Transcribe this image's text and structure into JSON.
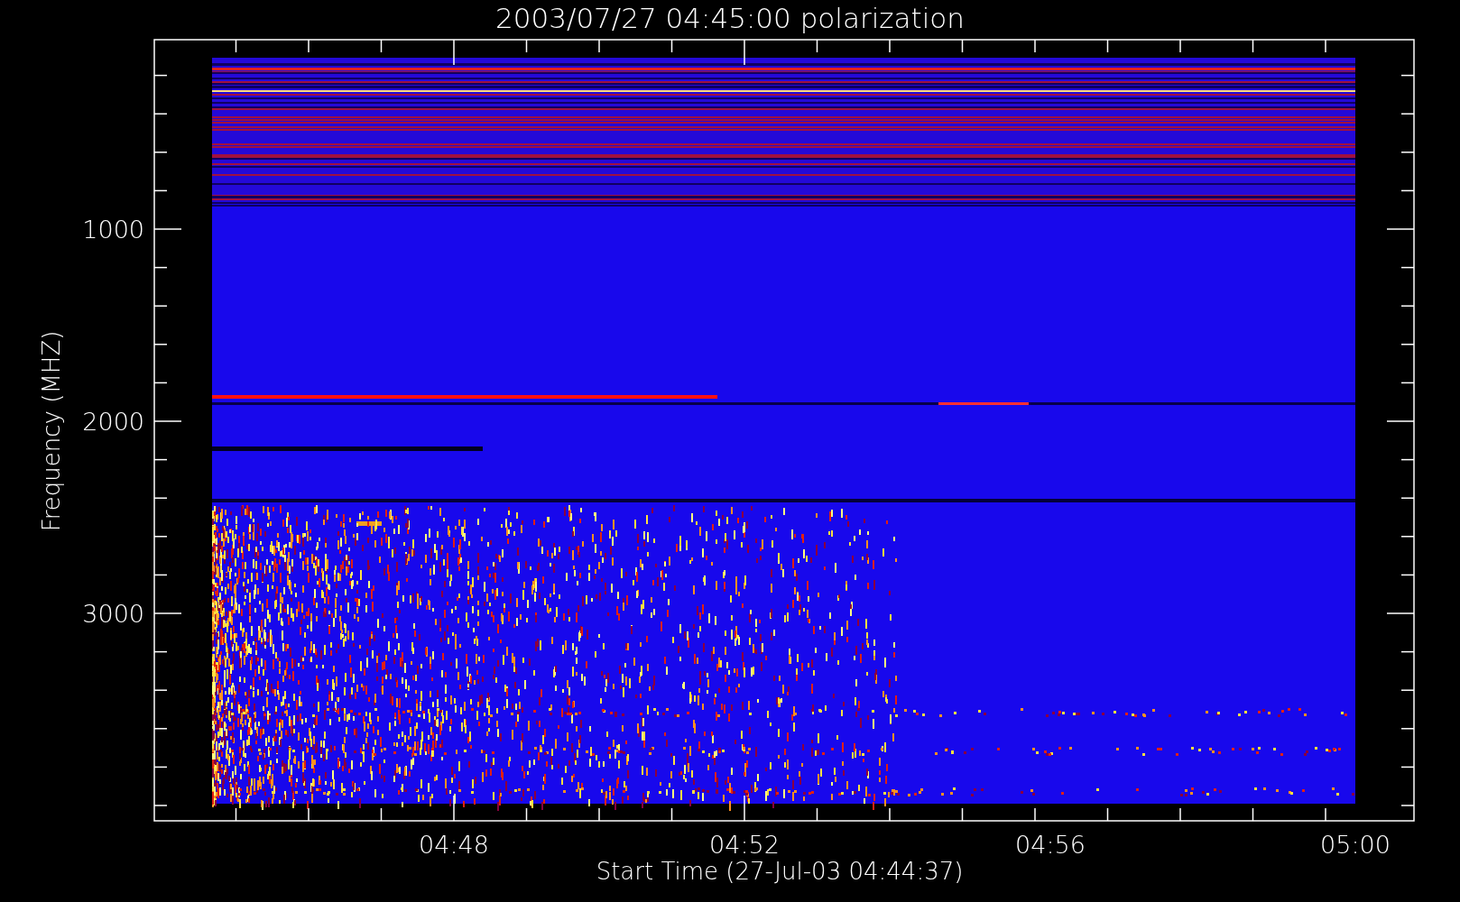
{
  "title": "2003/07/27 04:45:00 polarization",
  "ylabel": "Frequency (MHZ)",
  "xlabel": "Start Time (27-Jul-03 04:44:37)",
  "y_tick_labels": [
    "1000",
    "2000",
    "3000"
  ],
  "x_tick_labels": [
    "04:48",
    "04:52",
    "04:56",
    "05:00"
  ]
}
